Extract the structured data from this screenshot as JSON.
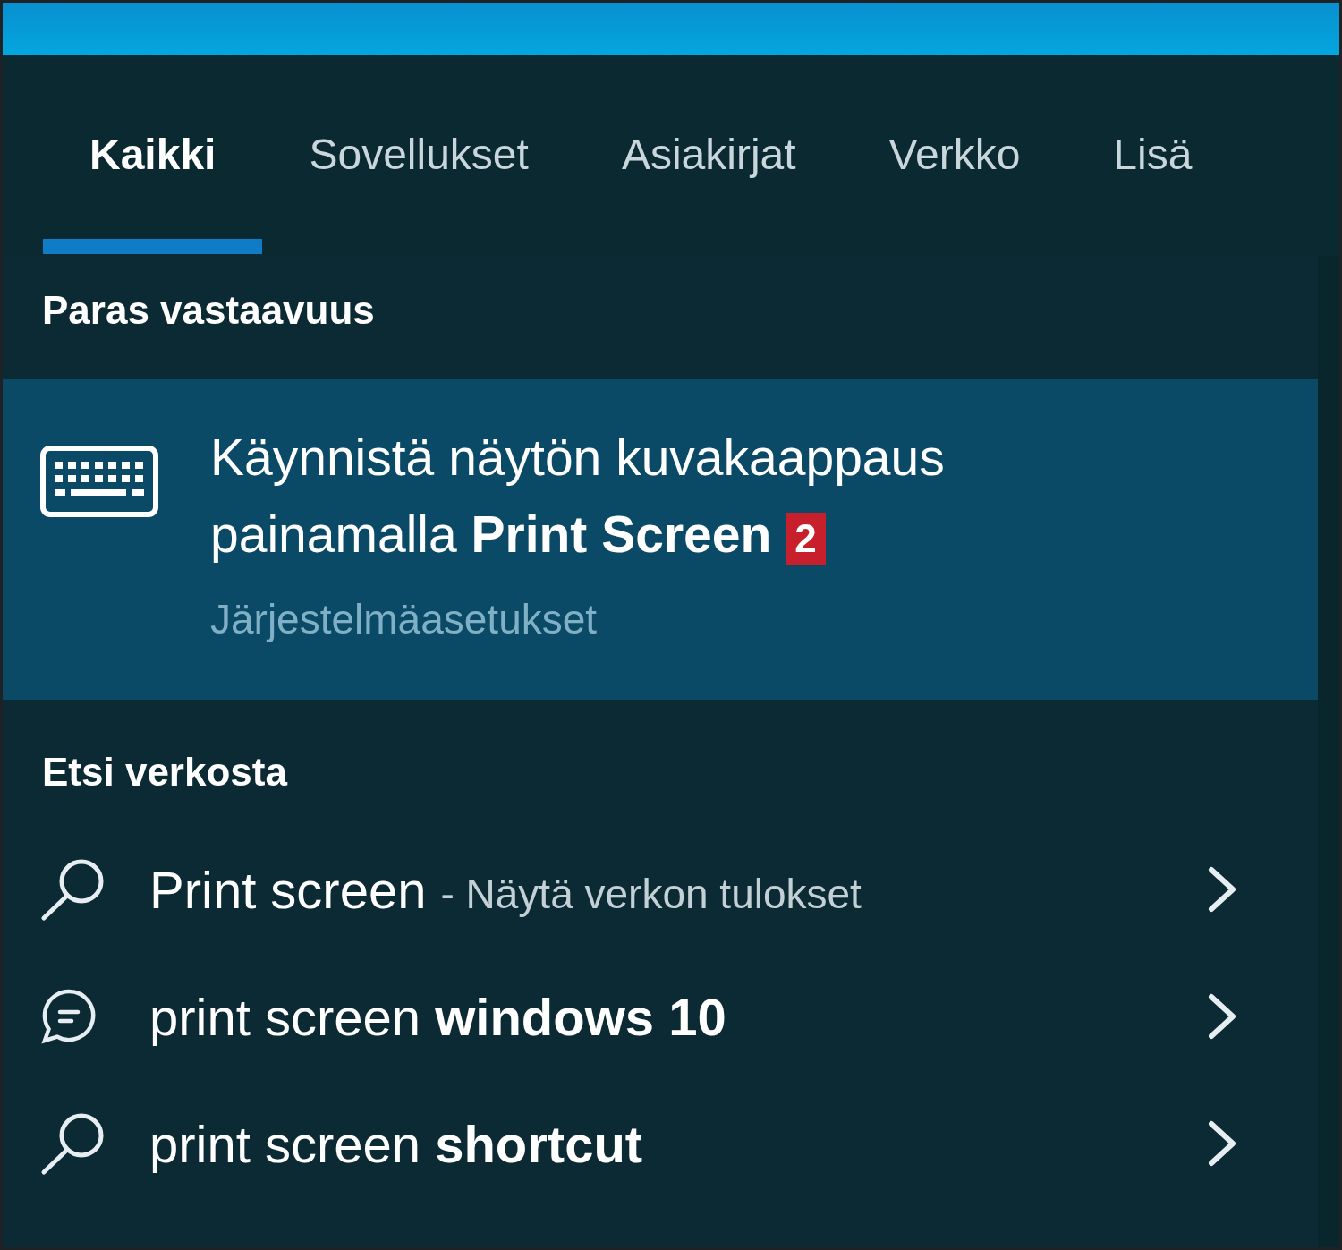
{
  "tabs": [
    {
      "label": "Kaikki",
      "selected": true
    },
    {
      "label": "Sovellukset",
      "selected": false
    },
    {
      "label": "Asiakirjat",
      "selected": false
    },
    {
      "label": "Verkko",
      "selected": false
    },
    {
      "label": "Lisä",
      "selected": false
    }
  ],
  "best_match": {
    "heading": "Paras vastaavuus",
    "title": "Käynnistä näytön kuvakaappaus painamalla **Print Screen**",
    "badge": "2",
    "subtitle": "Järjestelmäasetukset"
  },
  "web": {
    "heading": "Etsi verkosta",
    "items": [
      {
        "kind": "search",
        "text": "Print screen",
        "suffix": "- Näytä verkon tulokset"
      },
      {
        "kind": "chat",
        "text": "print screen **windows 10**"
      },
      {
        "kind": "search",
        "text": "print screen **shortcut**"
      }
    ]
  }
}
